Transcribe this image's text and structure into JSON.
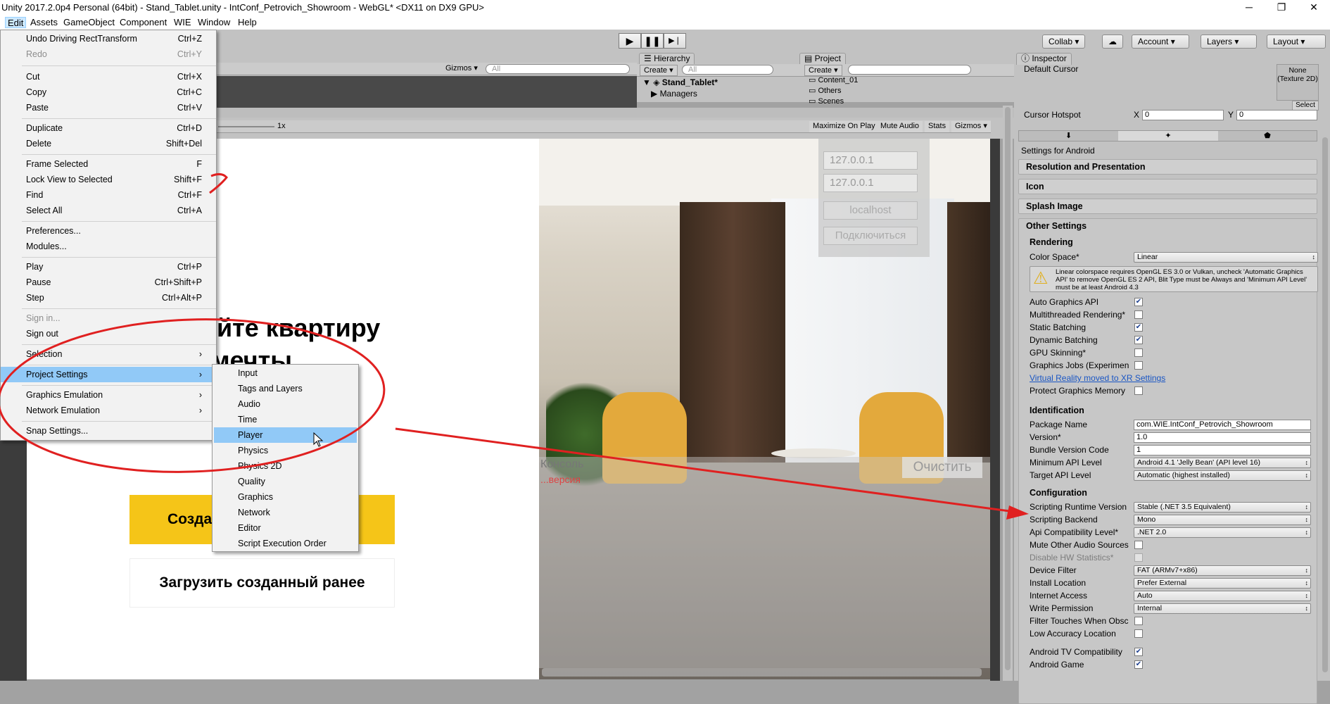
{
  "window": {
    "title": "Unity 2017.2.0p4 Personal (64bit) - Stand_Tablet.unity - IntConf_Petrovich_Showroom - WebGL* <DX11 on DX9 GPU>",
    "min": "─",
    "max": "❐",
    "close": "✕"
  },
  "menubar": [
    "Edit",
    "Assets",
    "GameObject",
    "Component",
    "WIE",
    "Window",
    "Help"
  ],
  "edit_menu": {
    "undo": {
      "label": "Undo Driving RectTransform",
      "shortcut": "Ctrl+Z"
    },
    "redo": {
      "label": "Redo",
      "shortcut": "Ctrl+Y"
    },
    "cut": {
      "label": "Cut",
      "shortcut": "Ctrl+X"
    },
    "copy": {
      "label": "Copy",
      "shortcut": "Ctrl+C"
    },
    "paste": {
      "label": "Paste",
      "shortcut": "Ctrl+V"
    },
    "duplicate": {
      "label": "Duplicate",
      "shortcut": "Ctrl+D"
    },
    "delete": {
      "label": "Delete",
      "shortcut": "Shift+Del"
    },
    "frame_selected": {
      "label": "Frame Selected",
      "shortcut": "F"
    },
    "lock_view": {
      "label": "Lock View to Selected",
      "shortcut": "Shift+F"
    },
    "find": {
      "label": "Find",
      "shortcut": "Ctrl+F"
    },
    "select_all": {
      "label": "Select All",
      "shortcut": "Ctrl+A"
    },
    "preferences": {
      "label": "Preferences..."
    },
    "modules": {
      "label": "Modules..."
    },
    "play": {
      "label": "Play",
      "shortcut": "Ctrl+P"
    },
    "pause": {
      "label": "Pause",
      "shortcut": "Ctrl+Shift+P"
    },
    "step": {
      "label": "Step",
      "shortcut": "Ctrl+Alt+P"
    },
    "sign_in": {
      "label": "Sign in..."
    },
    "sign_out": {
      "label": "Sign out"
    },
    "selection": {
      "label": "Selection"
    },
    "project_settings": {
      "label": "Project Settings"
    },
    "graphics_emulation": {
      "label": "Graphics Emulation"
    },
    "network_emulation": {
      "label": "Network Emulation"
    },
    "snap_settings": {
      "label": "Snap Settings..."
    },
    "arrow": "›"
  },
  "project_settings_menu": [
    "Input",
    "Tags and Layers",
    "Audio",
    "Time",
    "Player",
    "Physics",
    "Physics 2D",
    "Quality",
    "Graphics",
    "Network",
    "Editor",
    "Script Execution Order"
  ],
  "toolbar": {
    "collab": "Collab ▾",
    "cloud": "☁",
    "account": "Account ▾",
    "layers": "Layers ▾",
    "layout": "Layout ▾",
    "play": "▶",
    "pause": "❚❚",
    "step": "▶❘"
  },
  "scene_bar": {
    "gizmos": "Gizmos ▾",
    "search_placeholder": "All"
  },
  "game_bar": {
    "scale": "1x",
    "maximize": "Maximize On Play",
    "mute": "Mute Audio",
    "stats": "Stats",
    "gizmos": "Gizmos ▾"
  },
  "hierarchy": {
    "tab": "Hierarchy",
    "create": "Create ▾",
    "search_placeholder": "All",
    "scene": "Stand_Tablet*",
    "item": "Managers"
  },
  "project": {
    "tab": "Project",
    "create": "Create ▾",
    "items": [
      "Content_01",
      "Others",
      "Scenes"
    ]
  },
  "game": {
    "heading1": "йте квартиру",
    "heading2": "мечты",
    "create_button": "Созда",
    "load_button": "Загрузить созданный ранее",
    "ip1": "127.0.0.1",
    "ip2": "127.0.0.1",
    "localhost": "localhost",
    "connect": "Подключиться",
    "console": "Консоль",
    "console_sub": "...версия",
    "clear": "Очистить"
  },
  "inspector": {
    "tab": "Inspector",
    "default_cursor": "Default Cursor",
    "texture_none": "None (Texture 2D)",
    "select": "Select",
    "cursor_hotspot": "Cursor Hotspot",
    "x_label": "X",
    "x_val": "0",
    "y_label": "Y",
    "y_val": "0",
    "settings_for": "Settings for Android",
    "sections": [
      "Resolution and Presentation",
      "Icon",
      "Splash Image"
    ],
    "other_settings": "Other Settings",
    "rendering": "Rendering",
    "color_space": {
      "label": "Color Space*",
      "value": "Linear"
    },
    "warning": "Linear colorspace requires OpenGL ES 3.0 or Vulkan, uncheck 'Automatic Graphics API' to remove OpenGL ES 2 API, Blit Type must be Always and 'Minimum API Level' must be at least Android 4.3",
    "render_checks": [
      {
        "label": "Auto Graphics API",
        "checked": true
      },
      {
        "label": "Multithreaded Rendering*",
        "checked": false
      },
      {
        "label": "Static Batching",
        "checked": true
      },
      {
        "label": "Dynamic Batching",
        "checked": true
      },
      {
        "label": "GPU Skinning*",
        "checked": false
      },
      {
        "label": "Graphics Jobs (Experimen",
        "checked": false
      }
    ],
    "vr_link": "Virtual Reality moved to XR Settings",
    "protect": {
      "label": "Protect Graphics Memory",
      "checked": false
    },
    "identification": "Identification",
    "package_name": {
      "label": "Package Name",
      "value": "com.WIE.IntConf_Petrovich_Showroom"
    },
    "version": {
      "label": "Version*",
      "value": "1.0"
    },
    "bundle_code": {
      "label": "Bundle Version Code",
      "value": "1"
    },
    "min_api": {
      "label": "Minimum API Level",
      "value": "Android 4.1 'Jelly Bean' (API level 16)"
    },
    "target_api": {
      "label": "Target API Level",
      "value": "Automatic (highest installed)"
    },
    "configuration": "Configuration",
    "runtime": {
      "label": "Scripting Runtime Version",
      "value": "Stable (.NET 3.5 Equivalent)"
    },
    "backend": {
      "label": "Scripting Backend",
      "value": "Mono"
    },
    "api_compat": {
      "label": "Api Compatibility Level*",
      "value": ".NET 2.0"
    },
    "mute_other": {
      "label": "Mute Other Audio Sources",
      "checked": false
    },
    "disable_hw": {
      "label": "Disable HW Statistics*",
      "checked": false
    },
    "device_filter": {
      "label": "Device Filter",
      "value": "FAT (ARMv7+x86)"
    },
    "install_loc": {
      "label": "Install Location",
      "value": "Prefer External"
    },
    "internet": {
      "label": "Internet Access",
      "value": "Auto"
    },
    "write_perm": {
      "label": "Write Permission",
      "value": "Internal"
    },
    "filter_touches": {
      "label": "Filter Touches When Obsc",
      "checked": false
    },
    "low_accuracy": {
      "label": "Low Accuracy Location",
      "checked": false
    },
    "android_tv": {
      "label": "Android TV Compatibility",
      "checked": true
    },
    "android_game": {
      "label": "Android Game",
      "checked": true
    }
  },
  "colors": {
    "highlight": "#91c9f7",
    "annotation": "#e02020",
    "button_yellow": "#f5c518",
    "link": "#1a56c4"
  }
}
